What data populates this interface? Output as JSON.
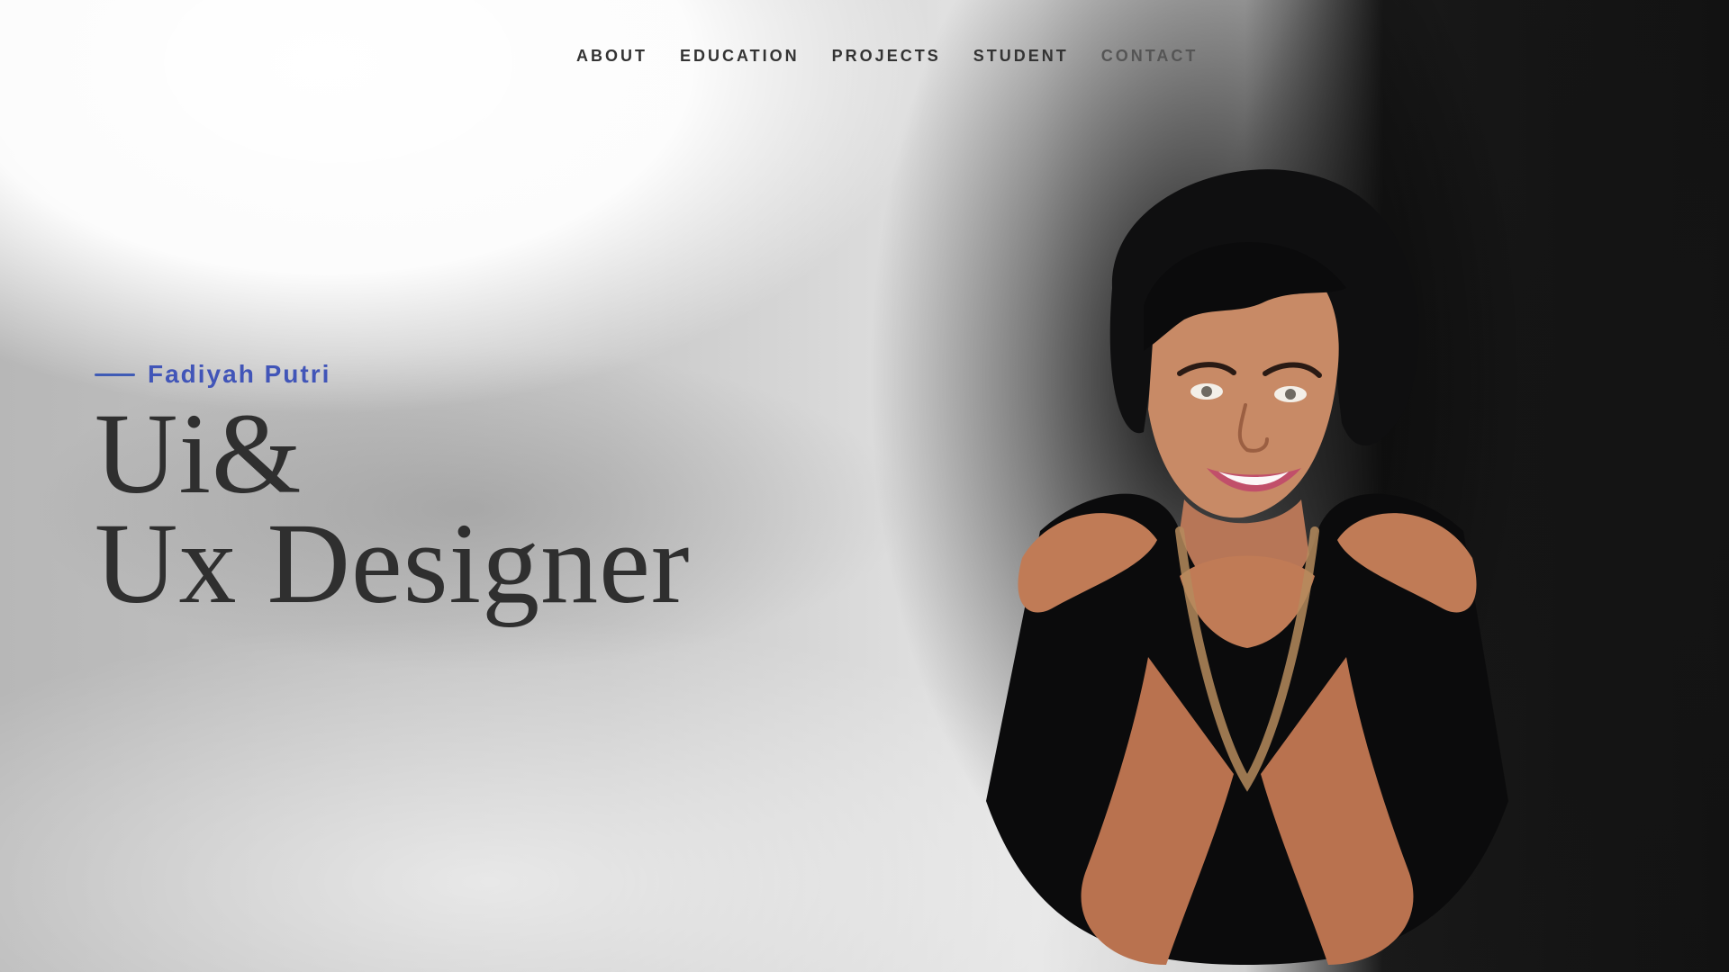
{
  "nav": {
    "items": [
      "ABOUT",
      "EDUCATION",
      "PROJECTS",
      "STUDENT",
      "CONTACT"
    ]
  },
  "hero": {
    "name": "Fadiyah Putri",
    "title_line1": "Ui&",
    "title_line2": "Ux Designer"
  },
  "colors": {
    "accent": "#4155b8",
    "text_dark": "#2f2f2f"
  },
  "icons": {
    "portrait": "person-photo"
  }
}
